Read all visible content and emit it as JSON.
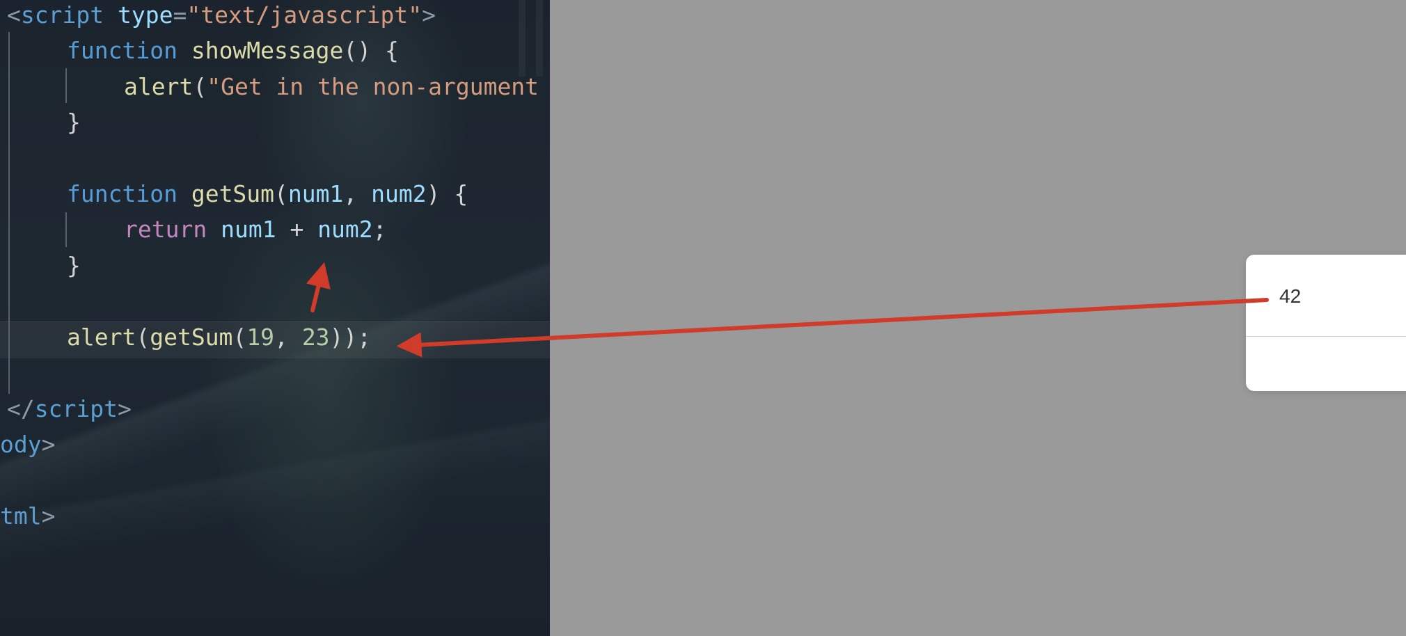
{
  "editor": {
    "lines": [
      [
        [
          "c-punc",
          "<"
        ],
        [
          "c-tag",
          "script"
        ],
        [
          "c-op",
          " "
        ],
        [
          "c-attr",
          "type"
        ],
        [
          "c-punc",
          "="
        ],
        [
          "c-str",
          "\"text/javascript\""
        ],
        [
          "c-punc",
          ">"
        ]
      ],
      [
        [
          "c-kw",
          "function"
        ],
        [
          "c-op",
          " "
        ],
        [
          "c-fn",
          "showMessage"
        ],
        [
          "c-op",
          "() {"
        ]
      ],
      [
        [
          "c-fn",
          "alert"
        ],
        [
          "c-op",
          "("
        ],
        [
          "c-str",
          "\"Get in the non-argument"
        ]
      ],
      [
        [
          "c-op",
          "}"
        ]
      ],
      [],
      [
        [
          "c-kw",
          "function"
        ],
        [
          "c-op",
          " "
        ],
        [
          "c-fn",
          "getSum"
        ],
        [
          "c-op",
          "("
        ],
        [
          "c-param",
          "num1"
        ],
        [
          "c-op",
          ", "
        ],
        [
          "c-param",
          "num2"
        ],
        [
          "c-op",
          ") {"
        ]
      ],
      [
        [
          "c-ret",
          "return"
        ],
        [
          "c-op",
          " "
        ],
        [
          "c-param",
          "num1"
        ],
        [
          "c-op",
          " + "
        ],
        [
          "c-param",
          "num2"
        ],
        [
          "c-op",
          ";"
        ]
      ],
      [
        [
          "c-op",
          "}"
        ]
      ],
      [],
      [
        [
          "c-fn",
          "alert"
        ],
        [
          "c-op",
          "("
        ],
        [
          "c-fn",
          "getSum"
        ],
        [
          "c-op",
          "("
        ],
        [
          "c-num",
          "19"
        ],
        [
          "c-op",
          ", "
        ],
        [
          "c-num",
          "23"
        ],
        [
          "c-op",
          "));"
        ]
      ],
      [],
      [
        [
          "c-punc",
          "</"
        ],
        [
          "c-tag",
          "script"
        ],
        [
          "c-punc",
          ">"
        ]
      ],
      [
        [
          "c-tag",
          "ody"
        ],
        [
          "c-punc",
          ">"
        ]
      ],
      [],
      [
        [
          "c-tag",
          "tml"
        ],
        [
          "c-punc",
          ">"
        ]
      ]
    ]
  },
  "alert": {
    "message": "42"
  },
  "colors": {
    "annotation_arrow": "#d03b2a",
    "page_background": "#9a9a9a"
  }
}
